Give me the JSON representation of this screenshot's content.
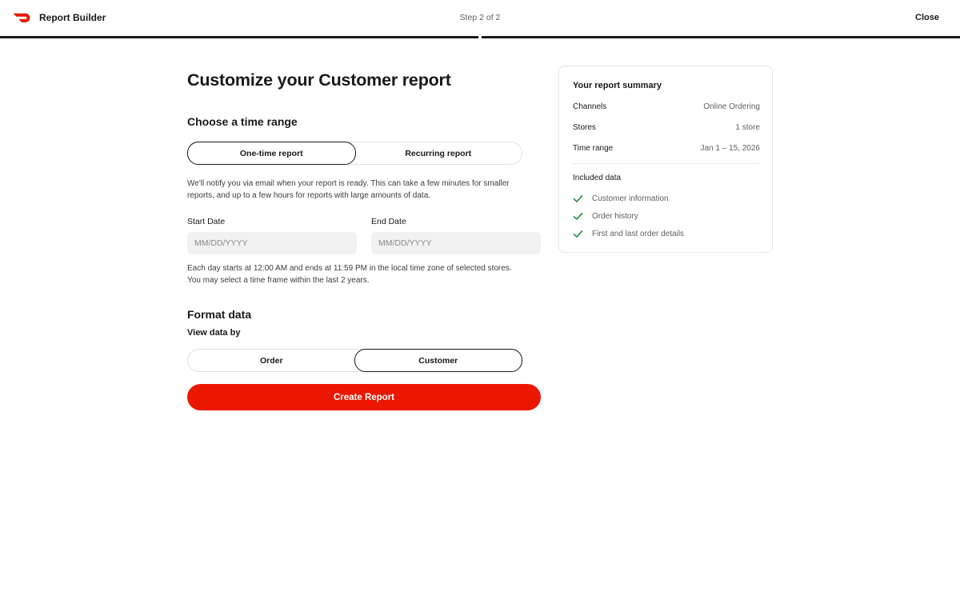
{
  "header": {
    "app_title": "Report Builder",
    "step": "Step 2 of 2",
    "close_label": "Close",
    "brand_color": "#eb1700"
  },
  "main": {
    "title": "Customize your Customer report",
    "time_range": {
      "heading": "Choose a time range",
      "options": [
        {
          "label": "One-time report",
          "selected": true
        },
        {
          "label": "Recurring report",
          "selected": false
        }
      ],
      "help": "We'll notify you via email when your report is ready. This can take a few minutes for smaller reports, and up to a few hours for reports with large amounts of data.",
      "start_label": "Start Date",
      "start_placeholder": "MM/DD/YYYY",
      "end_label": "End Date",
      "end_placeholder": "MM/DD/YYYY",
      "note_line1": "Each day starts at 12:00 AM and ends at 11:59 PM in the local time zone of selected stores.",
      "note_line2": "You may select a time frame within the last 2 years."
    },
    "format": {
      "heading": "Format data",
      "view_by_label": "View data by",
      "options": [
        {
          "label": "Order",
          "selected": false
        },
        {
          "label": "Customer",
          "selected": true
        }
      ]
    },
    "create_label": "Create Report"
  },
  "summary": {
    "title": "Your report summary",
    "rows": [
      {
        "key": "Channels",
        "value": "Online Ordering"
      },
      {
        "key": "Stores",
        "value": "1 store"
      },
      {
        "key": "Time range",
        "value": "Jan 1 – 15, 2026"
      }
    ],
    "included_label": "Included data",
    "included": [
      "Customer information",
      "Order history",
      "First and last order details"
    ],
    "check_color": "#1f8a3b"
  }
}
